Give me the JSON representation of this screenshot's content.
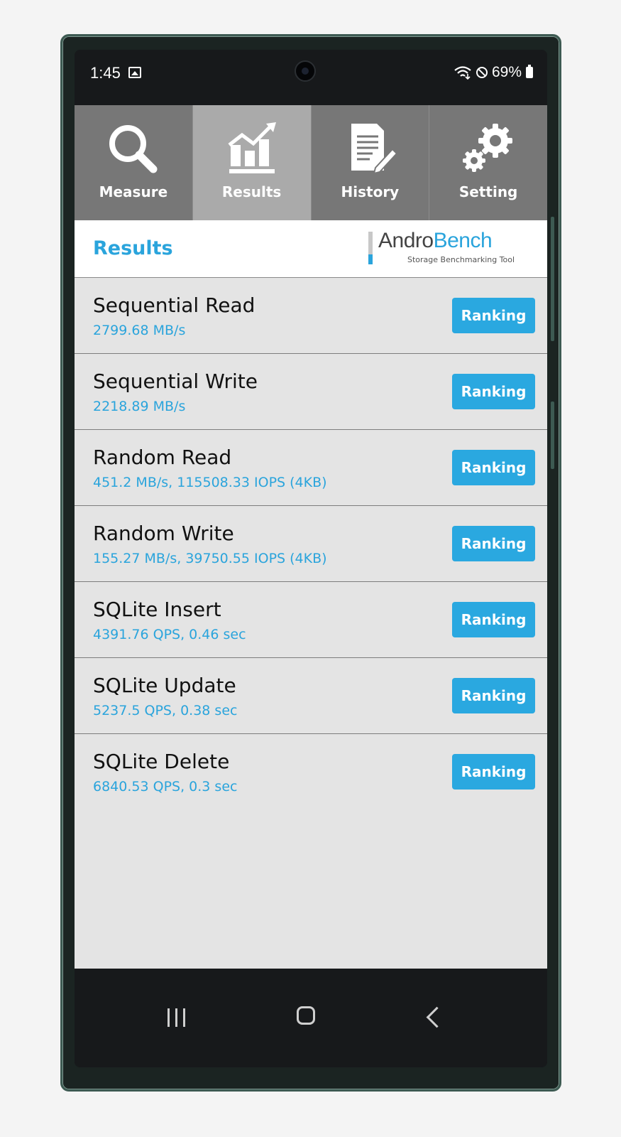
{
  "status_bar": {
    "time": "1:45",
    "battery": "69%",
    "icons": [
      "image-icon",
      "wifi-icon",
      "dnd-icon",
      "battery-icon"
    ]
  },
  "tabs": [
    {
      "label": "Measure",
      "icon": "search-icon",
      "active": false
    },
    {
      "label": "Results",
      "icon": "chart-icon",
      "active": true
    },
    {
      "label": "History",
      "icon": "document-icon",
      "active": false
    },
    {
      "label": "Setting",
      "icon": "gear-icon",
      "active": false
    }
  ],
  "header": {
    "title": "Results",
    "logo_andro": "Andro",
    "logo_bench": "Bench",
    "logo_tagline": "Storage Benchmarking Tool"
  },
  "results": [
    {
      "name": "Sequential Read",
      "value": "2799.68 MB/s",
      "button": "Ranking"
    },
    {
      "name": "Sequential Write",
      "value": "2218.89 MB/s",
      "button": "Ranking"
    },
    {
      "name": "Random Read",
      "value": "451.2 MB/s, 115508.33 IOPS (4KB)",
      "button": "Ranking"
    },
    {
      "name": "Random Write",
      "value": "155.27 MB/s, 39750.55 IOPS (4KB)",
      "button": "Ranking"
    },
    {
      "name": "SQLite Insert",
      "value": "4391.76 QPS, 0.46 sec",
      "button": "Ranking"
    },
    {
      "name": "SQLite Update",
      "value": "5237.5 QPS, 0.38 sec",
      "button": "Ranking"
    },
    {
      "name": "SQLite Delete",
      "value": "6840.53 QPS, 0.3 sec",
      "button": "Ranking"
    }
  ],
  "colors": {
    "accent": "#2aa4dc",
    "tab_bg": "#777777",
    "tab_active_bg": "#aaaaaa",
    "list_bg": "#e4e4e4"
  }
}
